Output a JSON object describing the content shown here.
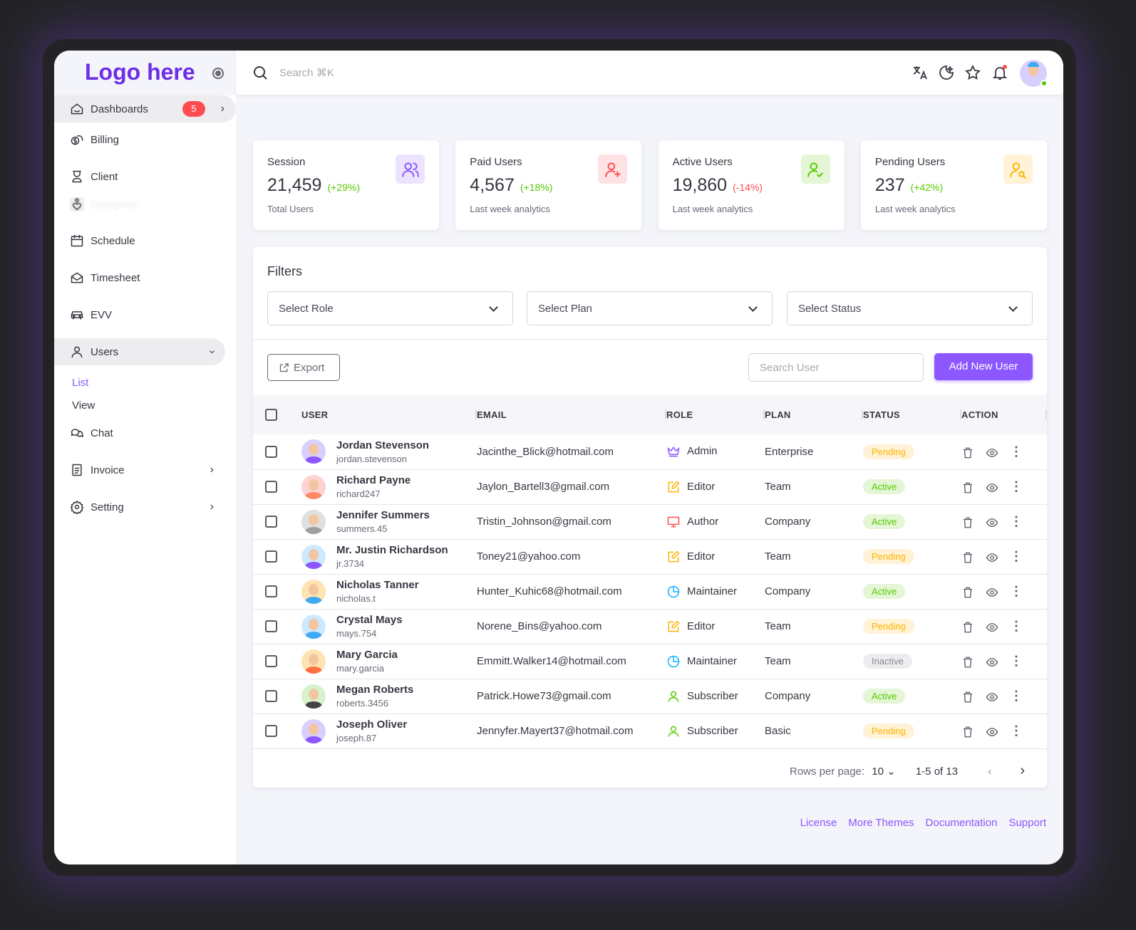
{
  "sidebar": {
    "logo": "Logo here",
    "items": [
      {
        "label": "Dashboards",
        "icon": "home-icon",
        "badge": "5"
      },
      {
        "label": "Billing",
        "icon": "coins-icon"
      },
      {
        "label": "Client",
        "icon": "hourglass-user-icon"
      },
      {
        "label": "Caregiver",
        "icon": "heart-user-icon"
      },
      {
        "label": "Schedule",
        "icon": "calendar-icon"
      },
      {
        "label": "Timesheet",
        "icon": "mail-open-icon"
      },
      {
        "label": "EVV",
        "icon": "car-icon"
      },
      {
        "label": "Users",
        "icon": "user-icon"
      },
      {
        "label": "Chat",
        "icon": "chat-icon"
      },
      {
        "label": "Invoice",
        "icon": "file-icon"
      },
      {
        "label": "Setting",
        "icon": "gear-icon"
      }
    ],
    "users_sub": [
      "List",
      "View"
    ]
  },
  "topbar": {
    "search_placeholder": "Search ⌘K"
  },
  "stats": [
    {
      "title": "Session",
      "value": "21,459",
      "delta": "(+29%)",
      "sub": "Total Users",
      "color": "#8c57ff",
      "bg": "#ece3ff",
      "up": true
    },
    {
      "title": "Paid Users",
      "value": "4,567",
      "delta": "(+18%)",
      "sub": "Last week analytics",
      "color": "#ff4c51",
      "bg": "#ffe2e3",
      "up": true
    },
    {
      "title": "Active Users",
      "value": "19,860",
      "delta": "(-14%)",
      "sub": "Last week analytics",
      "color": "#56ca00",
      "bg": "#e4f6d6",
      "up": false
    },
    {
      "title": "Pending Users",
      "value": "237",
      "delta": "(+42%)",
      "sub": "Last week analytics",
      "color": "#ffb400",
      "bg": "#fff2d6",
      "up": true
    }
  ],
  "filters": {
    "title": "Filters",
    "role": "Select Role",
    "plan": "Select Plan",
    "status": "Select Status"
  },
  "toolbar": {
    "export": "Export",
    "search_placeholder": "Search User",
    "add": "Add New User"
  },
  "table": {
    "headers": [
      "USER",
      "EMAIL",
      "ROLE",
      "PLAN",
      "STATUS",
      "ACTION"
    ],
    "rows": [
      {
        "name": "Jordan Stevenson",
        "handle": "jordan.stevenson",
        "email": "Jacinthe_Blick@hotmail.com",
        "role": "Admin",
        "plan": "Enterprise",
        "status": "Pending"
      },
      {
        "name": "Richard Payne",
        "handle": "richard247",
        "email": "Jaylon_Bartell3@gmail.com",
        "role": "Editor",
        "plan": "Team",
        "status": "Active"
      },
      {
        "name": "Jennifer Summers",
        "handle": "summers.45",
        "email": "Tristin_Johnson@gmail.com",
        "role": "Author",
        "plan": "Company",
        "status": "Active"
      },
      {
        "name": "Mr. Justin Richardson",
        "handle": "jr.3734",
        "email": "Toney21@yahoo.com",
        "role": "Editor",
        "plan": "Team",
        "status": "Pending"
      },
      {
        "name": "Nicholas Tanner",
        "handle": "nicholas.t",
        "email": "Hunter_Kuhic68@hotmail.com",
        "role": "Maintainer",
        "plan": "Company",
        "status": "Active"
      },
      {
        "name": "Crystal Mays",
        "handle": "mays.754",
        "email": "Norene_Bins@yahoo.com",
        "role": "Editor",
        "plan": "Team",
        "status": "Pending"
      },
      {
        "name": "Mary Garcia",
        "handle": "mary.garcia",
        "email": "Emmitt.Walker14@hotmail.com",
        "role": "Maintainer",
        "plan": "Team",
        "status": "Inactive"
      },
      {
        "name": "Megan Roberts",
        "handle": "roberts.3456",
        "email": "Patrick.Howe73@gmail.com",
        "role": "Subscriber",
        "plan": "Company",
        "status": "Active"
      },
      {
        "name": "Joseph Oliver",
        "handle": "joseph.87",
        "email": "Jennyfer.Mayert37@hotmail.com",
        "role": "Subscriber",
        "plan": "Basic",
        "status": "Pending"
      }
    ]
  },
  "pagination": {
    "rows_label": "Rows per page:",
    "rows_value": "10",
    "range": "1-5 of 13"
  },
  "footer": {
    "links": [
      "License",
      "More Themes",
      "Documentation",
      "Support"
    ]
  }
}
